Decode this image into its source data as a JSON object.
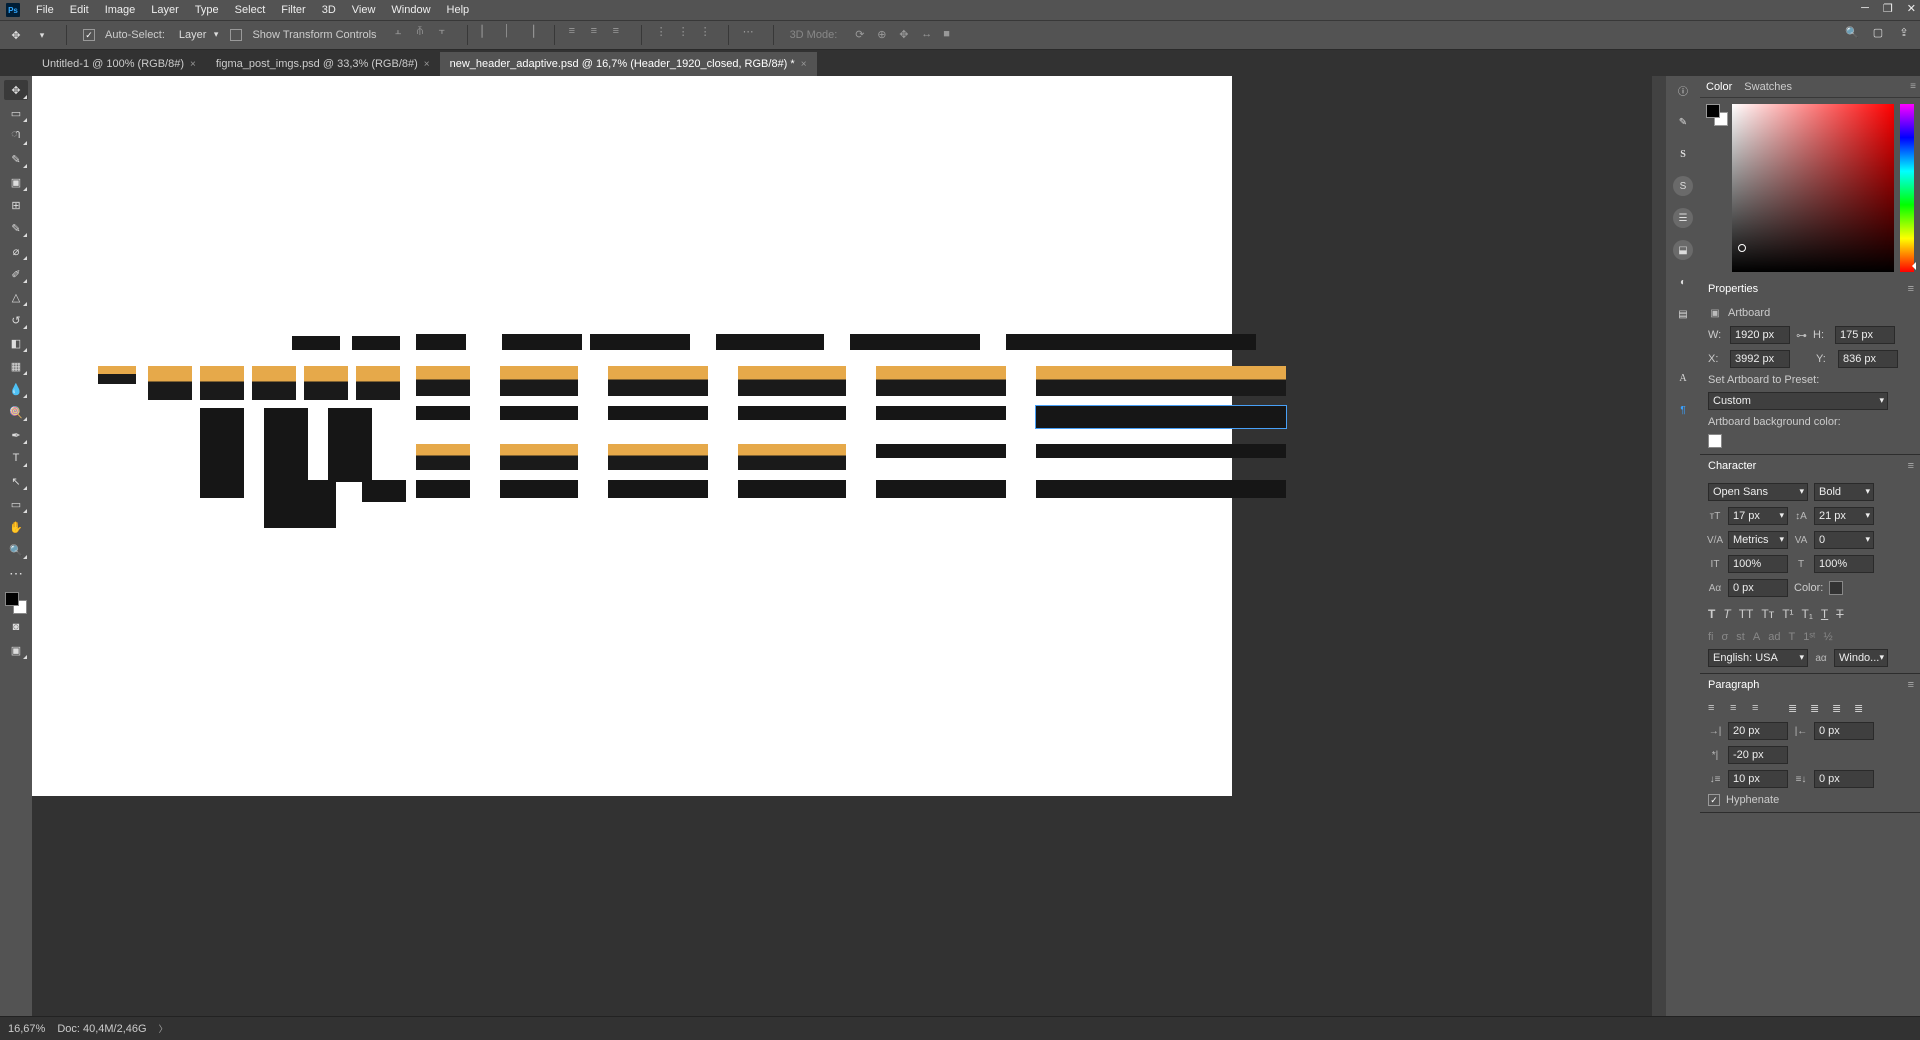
{
  "menu": [
    "File",
    "Edit",
    "Image",
    "Layer",
    "Type",
    "Select",
    "Filter",
    "3D",
    "View",
    "Window",
    "Help"
  ],
  "options": {
    "auto_select": "Auto-Select:",
    "layer_dd": "Layer",
    "show_transform": "Show Transform Controls",
    "mode_3d": "3D Mode:"
  },
  "tabs": [
    {
      "label": "Untitled-1 @ 100% (RGB/8#)",
      "active": false
    },
    {
      "label": "figma_post_imgs.psd @ 33,3% (RGB/8#)",
      "active": false
    },
    {
      "label": "new_header_adaptive.psd @ 16,7% (Header_1920_closed, RGB/8#) *",
      "active": true
    }
  ],
  "color_panel": {
    "tab1": "Color",
    "tab2": "Swatches"
  },
  "properties": {
    "title": "Properties",
    "type": "Artboard",
    "W_lbl": "W:",
    "W": "1920 px",
    "H_lbl": "H:",
    "H": "175 px",
    "X_lbl": "X:",
    "X": "3992 px",
    "Y_lbl": "Y:",
    "Y": "836 px",
    "preset_lbl": "Set Artboard to Preset:",
    "preset": "Custom",
    "bgcolor_lbl": "Artboard background color:"
  },
  "character": {
    "title": "Character",
    "font": "Open Sans",
    "style": "Bold",
    "size": "17 px",
    "leading": "21 px",
    "kerning": "Metrics",
    "tracking": "0",
    "vscale": "100%",
    "hscale": "100%",
    "baseline": "0 px",
    "color_lbl": "Color:",
    "lang": "English: USA",
    "aa": "Windo..."
  },
  "paragraph": {
    "title": "Paragraph",
    "indent_left": "20 px",
    "indent_right": "0 px",
    "indent_first": "-20 px",
    "space_before": "10 px",
    "space_after": "0 px",
    "hyphenate": "Hyphenate"
  },
  "status": {
    "zoom": "16,67%",
    "doc": "Doc: 40,4M/2,46G"
  }
}
